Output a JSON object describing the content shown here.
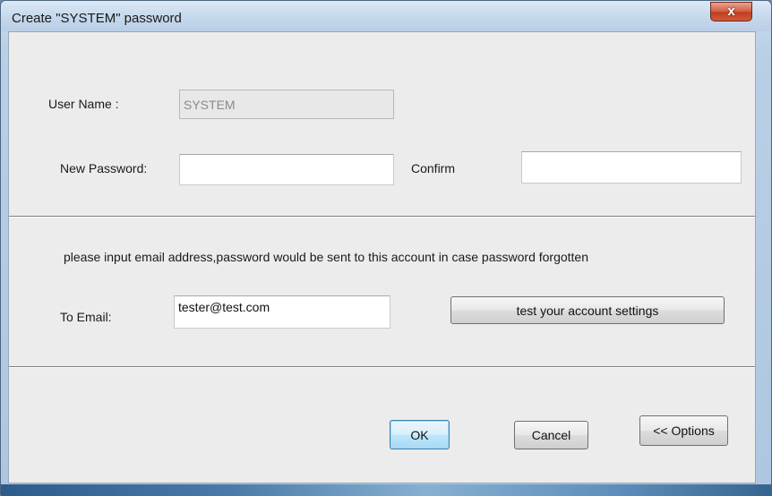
{
  "window": {
    "title": "Create \"SYSTEM\" password",
    "close_label": "x"
  },
  "form": {
    "user_name_label": "User Name :",
    "user_name_value": "SYSTEM",
    "new_password_label": "New Password:",
    "new_password_value": "",
    "confirm_label": "Confirm",
    "confirm_value": "",
    "email_hint": "please input email address,password would be sent to this account in case password forgotten",
    "to_email_label": "To Email:",
    "to_email_value": "tester@test.com",
    "test_button_label": "test your account settings"
  },
  "footer": {
    "ok_label": "OK",
    "cancel_label": "Cancel",
    "options_label": "<< Options"
  }
}
